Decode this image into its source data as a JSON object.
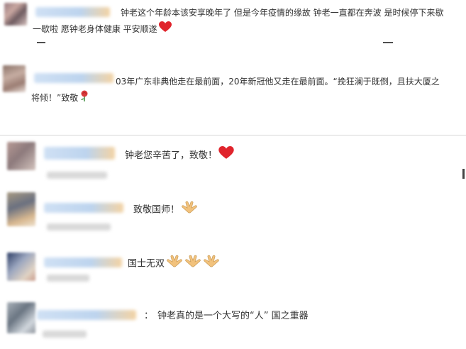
{
  "comments": [
    {
      "line1": "钟老这个年龄本该安享晚年了 但是今年疫情的缘故 钟老一直都在奔波 是时候停下来歇",
      "line2": "一歇啦 愿钟老身体健康 平安顺遂",
      "emoji": [
        "red-heart"
      ]
    },
    {
      "line1": "03年广东非典他走在最前面，20年新冠他又走在最前面。“挽狂澜于既倒，且扶大厦之",
      "line2": "将倾！”致敬",
      "emoji": [
        "rose"
      ]
    },
    {
      "text": "钟老您辛苦了，致敬！",
      "emoji": [
        "red-heart"
      ]
    },
    {
      "text": "致敬国师！",
      "emoji": [
        "folded-hands"
      ]
    },
    {
      "text": "国士无双",
      "emoji": [
        "folded-hands",
        "folded-hands",
        "folded-hands"
      ]
    },
    {
      "prefix": "：",
      "text": "钟老真的是一个大写的“人” 国之重器",
      "emoji": []
    }
  ],
  "colors": {
    "heart": "#e0242c",
    "hands": "#f2c27c",
    "rose": "#d93a3a",
    "divider": "#d6d6d6"
  }
}
